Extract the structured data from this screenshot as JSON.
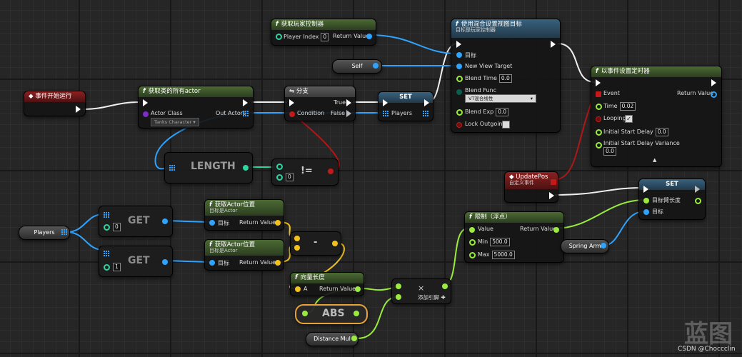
{
  "nodes": {
    "begin_play": {
      "title": "事件开始运行"
    },
    "get_all_actors": {
      "title": "获取类的所有actor",
      "actor_class_label": "Actor Class",
      "actor_class_value": "Tanks Character",
      "out_actors_label": "Out Actors"
    },
    "branch": {
      "title": "分支",
      "true_label": "True",
      "false_label": "False",
      "condition_label": "Condition"
    },
    "set_players": {
      "title": "SET",
      "players_label": "Players"
    },
    "get_player_controller": {
      "title": "获取玩家控制器",
      "player_index_label": "Player Index",
      "player_index_value": "0",
      "return_label": "Return Value"
    },
    "set_view_target": {
      "title": "使用混合设置视图目标",
      "subtitle": "目标是玩家控制器",
      "target_label": "目标",
      "new_view_target_label": "New View Target",
      "blend_time_label": "Blend Time",
      "blend_time_value": "0.0",
      "blend_func_label": "Blend Func",
      "blend_func_value": "VT混合线性",
      "blend_exp_label": "Blend Exp",
      "blend_exp_value": "0.0",
      "lock_outgoing_label": "Lock Outgoing"
    },
    "self_node": {
      "label": "Self"
    },
    "set_timer": {
      "title": "以事件设置定时器",
      "event_label": "Event",
      "return_label": "Return Value",
      "time_label": "Time",
      "time_value": "0.02",
      "looping_label": "Looping",
      "initial_delay_label": "Initial Start Delay",
      "initial_delay_value": "0.0",
      "variance_label": "Initial Start Delay Variance",
      "variance_value": "0.0"
    },
    "length": {
      "label": "LENGTH"
    },
    "not_equal": {
      "op": "!=",
      "value": "0"
    },
    "update_pos": {
      "title": "UpdatePos",
      "subtitle": "自定义事件"
    },
    "set_arm": {
      "title": "SET",
      "arm_length_label": "目标臂长度",
      "target_label": "目标"
    },
    "players_var": {
      "label": "Players"
    },
    "get1": {
      "label": "GET",
      "index": "0"
    },
    "get2": {
      "label": "GET",
      "index": "1"
    },
    "get_loc1": {
      "title": "获取Actor位置",
      "subtitle": "目标是Actor",
      "target_label": "目标",
      "return_label": "Return Value"
    },
    "get_loc2": {
      "title": "获取Actor位置",
      "subtitle": "目标是Actor",
      "target_label": "目标",
      "return_label": "Return Value"
    },
    "subtract": {
      "op": "-"
    },
    "vector_length": {
      "title": "向量长度",
      "a_label": "A",
      "return_label": "Return Value"
    },
    "clamp": {
      "title": "限制（浮点）",
      "value_label": "Value",
      "return_label": "Return Value",
      "min_label": "Min",
      "min_value": "500.0",
      "max_label": "Max",
      "max_value": "5000.0"
    },
    "spring_arm": {
      "label": "Spring Arm"
    },
    "multiply": {
      "op": "×",
      "add_pin_label": "添加引脚 ✚"
    },
    "abs": {
      "label": "ABS"
    },
    "distance_mul": {
      "label": "Distance Mul"
    }
  },
  "watermark": "蓝图",
  "credit": "CSDN @Choccclin"
}
